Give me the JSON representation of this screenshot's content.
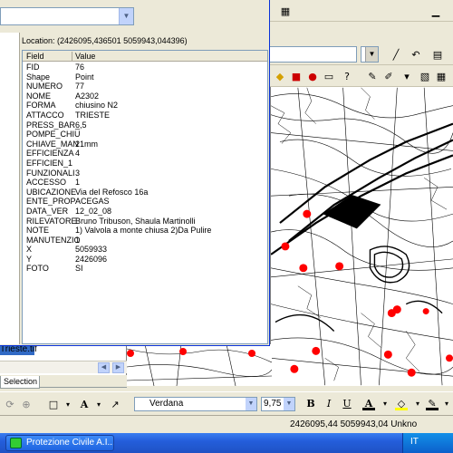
{
  "identify_window": {
    "layer_dropdown_value": "",
    "location_label": "Location:",
    "location_value": "(2426095,436501 5059943,044396)",
    "grid_headers": {
      "field": "Field",
      "value": "Value"
    },
    "rows": [
      {
        "field": "FID",
        "value": "76"
      },
      {
        "field": "Shape",
        "value": "Point"
      },
      {
        "field": "NUMERO",
        "value": "77"
      },
      {
        "field": "NOME",
        "value": "A2302"
      },
      {
        "field": "FORMA",
        "value": "chiusino N2"
      },
      {
        "field": "ATTACCO",
        "value": "TRIESTE"
      },
      {
        "field": "PRESS_BAR_",
        "value": "6,5"
      },
      {
        "field": "POMPE_CHIU",
        "value": ""
      },
      {
        "field": "CHIAVE_MAN",
        "value": "21mm"
      },
      {
        "field": "EFFICIENZA",
        "value": "4"
      },
      {
        "field": "EFFICIEN_1",
        "value": ""
      },
      {
        "field": "FUNZIONALI",
        "value": "3"
      },
      {
        "field": "ACCESSO",
        "value": "1"
      },
      {
        "field": "UBICAZIONE",
        "value": "Via del Refosco 16a"
      },
      {
        "field": "ENTE_PROP",
        "value": "ACEGAS"
      },
      {
        "field": "DATA_VER",
        "value": "12_02_08"
      },
      {
        "field": "RILEVATORE",
        "value": "Bruno Tribuson, Shaula Martinolli"
      },
      {
        "field": "NOTE",
        "value": "1) Valvola a monte chiusa 2)Da Pulire"
      },
      {
        "field": "MANUTENZIO",
        "value": "1"
      },
      {
        "field": "X",
        "value": "5059933"
      },
      {
        "field": "Y",
        "value": "2426096"
      },
      {
        "field": "FOTO",
        "value": "SI"
      }
    ]
  },
  "toc": {
    "file_label": "Trieste.tif",
    "tab_selection": "Selection"
  },
  "format_toolbar": {
    "font_name": "Verdana",
    "font_size": "9,75",
    "bold": "B",
    "italic": "I",
    "underline": "U"
  },
  "status_bar": {
    "coordinates": "2426095,44  5059943,04 Unkno"
  },
  "taskbar": {
    "task_button": "Protezione Civile A.I....",
    "language": "IT"
  },
  "colors": {
    "hydrant_point": "#ff0000",
    "title_blue": "#0831d9",
    "taskbar_blue": "#245edb"
  }
}
